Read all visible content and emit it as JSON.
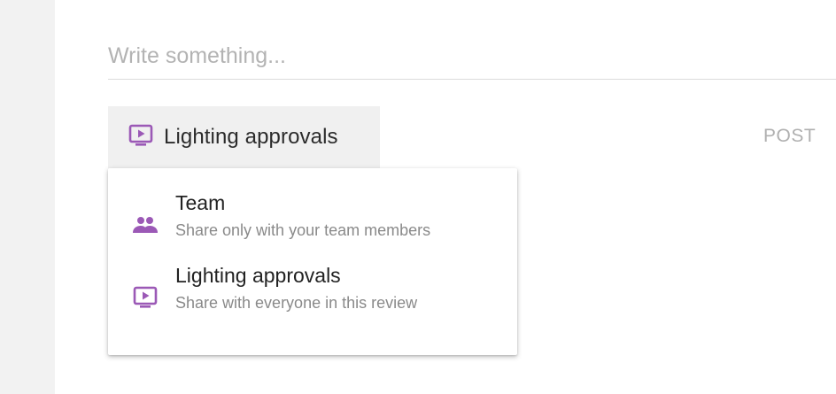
{
  "composer": {
    "placeholder": "Write something..."
  },
  "share_selector": {
    "selected_label": "Lighting approvals",
    "icon": "presentation-icon"
  },
  "actions": {
    "post_label": "POST"
  },
  "share_options": [
    {
      "title": "Team",
      "description": "Share only with your team members",
      "icon": "people-icon"
    },
    {
      "title": "Lighting approvals",
      "description": "Share with everyone in this review",
      "icon": "presentation-icon"
    }
  ],
  "colors": {
    "accent": "#9b59b6",
    "post_text": "#b0b0b0",
    "trigger_bg": "#f0f0f0"
  }
}
